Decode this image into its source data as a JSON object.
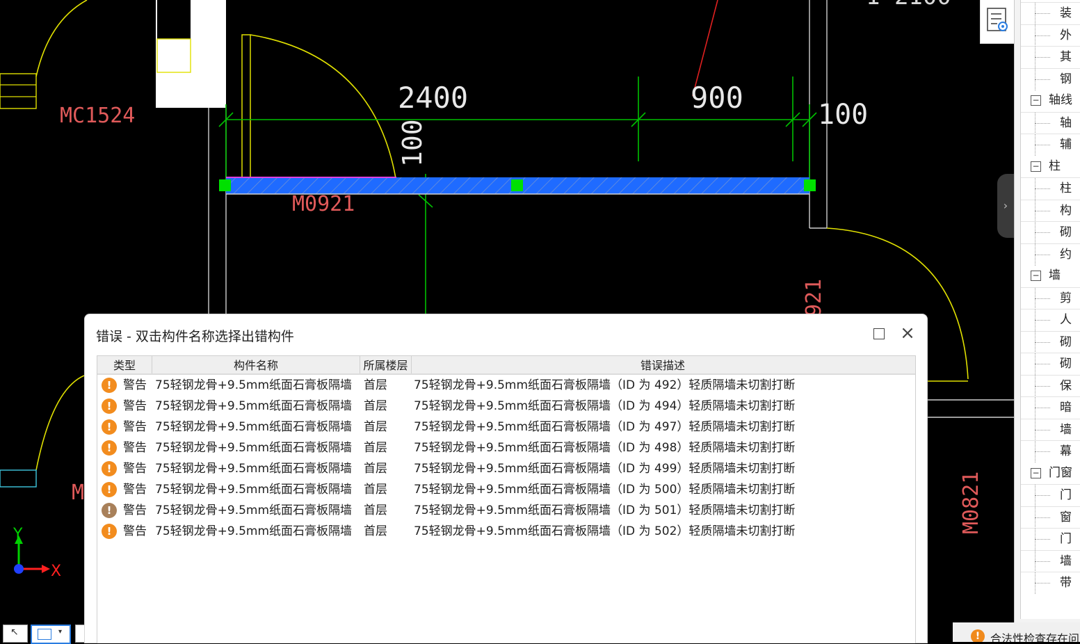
{
  "cad": {
    "labels": {
      "door_mc1524": "MC1524",
      "door_m0921": "M0921",
      "door_m0821": "M0821",
      "door_partial_rotated": "921",
      "door_partial_left": "M",
      "top_cut_text": "1 2100"
    },
    "dimensions": {
      "span_2400": "2400",
      "span_900": "900",
      "side_100": "100",
      "vertical_100": "100"
    },
    "axis": {
      "y": "Y",
      "x": "X"
    }
  },
  "dialog": {
    "title": "错误 - 双击构件名称选择出错构件",
    "columns": [
      "类型",
      "构件名称",
      "所属楼层",
      "错误描述"
    ],
    "rows": [
      {
        "type": "警告",
        "name": "75轻钢龙骨+9.5mm纸面石膏板隔墙",
        "floor": "首层",
        "desc": "75轻钢龙骨+9.5mm纸面石膏板隔墙（ID 为 492）轻质隔墙未切割打断",
        "icon_color": "#f28c1e"
      },
      {
        "type": "警告",
        "name": "75轻钢龙骨+9.5mm纸面石膏板隔墙",
        "floor": "首层",
        "desc": "75轻钢龙骨+9.5mm纸面石膏板隔墙（ID 为 494）轻质隔墙未切割打断",
        "icon_color": "#f28c1e"
      },
      {
        "type": "警告",
        "name": "75轻钢龙骨+9.5mm纸面石膏板隔墙",
        "floor": "首层",
        "desc": "75轻钢龙骨+9.5mm纸面石膏板隔墙（ID 为 497）轻质隔墙未切割打断",
        "icon_color": "#f28c1e"
      },
      {
        "type": "警告",
        "name": "75轻钢龙骨+9.5mm纸面石膏板隔墙",
        "floor": "首层",
        "desc": "75轻钢龙骨+9.5mm纸面石膏板隔墙（ID 为 498）轻质隔墙未切割打断",
        "icon_color": "#f28c1e"
      },
      {
        "type": "警告",
        "name": "75轻钢龙骨+9.5mm纸面石膏板隔墙",
        "floor": "首层",
        "desc": "75轻钢龙骨+9.5mm纸面石膏板隔墙（ID 为 499）轻质隔墙未切割打断",
        "icon_color": "#f28c1e"
      },
      {
        "type": "警告",
        "name": "75轻钢龙骨+9.5mm纸面石膏板隔墙",
        "floor": "首层",
        "desc": "75轻钢龙骨+9.5mm纸面石膏板隔墙（ID 为 500）轻质隔墙未切割打断",
        "icon_color": "#f28c1e"
      },
      {
        "type": "警告",
        "name": "75轻钢龙骨+9.5mm纸面石膏板隔墙",
        "floor": "首层",
        "desc": "75轻钢龙骨+9.5mm纸面石膏板隔墙（ID 为 501）轻质隔墙未切割打断",
        "icon_color": "#a8805a"
      },
      {
        "type": "警告",
        "name": "75轻钢龙骨+9.5mm纸面石膏板隔墙",
        "floor": "首层",
        "desc": "75轻钢龙骨+9.5mm纸面石膏板隔墙（ID 为 502）轻质隔墙未切割打断",
        "icon_color": "#f28c1e"
      }
    ]
  },
  "tree": {
    "items": [
      {
        "label": "装",
        "kind": "child"
      },
      {
        "label": "外",
        "kind": "child"
      },
      {
        "label": "其",
        "kind": "child"
      },
      {
        "label": "钢",
        "kind": "child"
      },
      {
        "label": "轴线",
        "kind": "group"
      },
      {
        "label": "轴",
        "kind": "child"
      },
      {
        "label": "辅",
        "kind": "child"
      },
      {
        "label": "柱",
        "kind": "group"
      },
      {
        "label": "柱",
        "kind": "child"
      },
      {
        "label": "构",
        "kind": "child"
      },
      {
        "label": "砌",
        "kind": "child"
      },
      {
        "label": "约",
        "kind": "child"
      },
      {
        "label": "墙",
        "kind": "group"
      },
      {
        "label": "剪",
        "kind": "child"
      },
      {
        "label": "人",
        "kind": "child"
      },
      {
        "label": "砌",
        "kind": "child"
      },
      {
        "label": "砌",
        "kind": "child"
      },
      {
        "label": "保",
        "kind": "child"
      },
      {
        "label": "暗",
        "kind": "child"
      },
      {
        "label": "墙",
        "kind": "child"
      },
      {
        "label": "幕",
        "kind": "child"
      },
      {
        "label": "门窗",
        "kind": "group"
      },
      {
        "label": "门",
        "kind": "child"
      },
      {
        "label": "窗",
        "kind": "child"
      },
      {
        "label": "门",
        "kind": "child"
      },
      {
        "label": "墙",
        "kind": "child"
      },
      {
        "label": "带",
        "kind": "child"
      }
    ],
    "collapse_symbol": "−"
  },
  "status": {
    "text": "合法性检查存在问",
    "icon": "!"
  },
  "colors": {
    "cad_background": "#000000",
    "selected_wall": "#1f6bff",
    "dimension_line": "#00c000",
    "door_arc": "#e0e000",
    "door_label": "#e05a5a",
    "warning_icon": "#f28c1e"
  }
}
